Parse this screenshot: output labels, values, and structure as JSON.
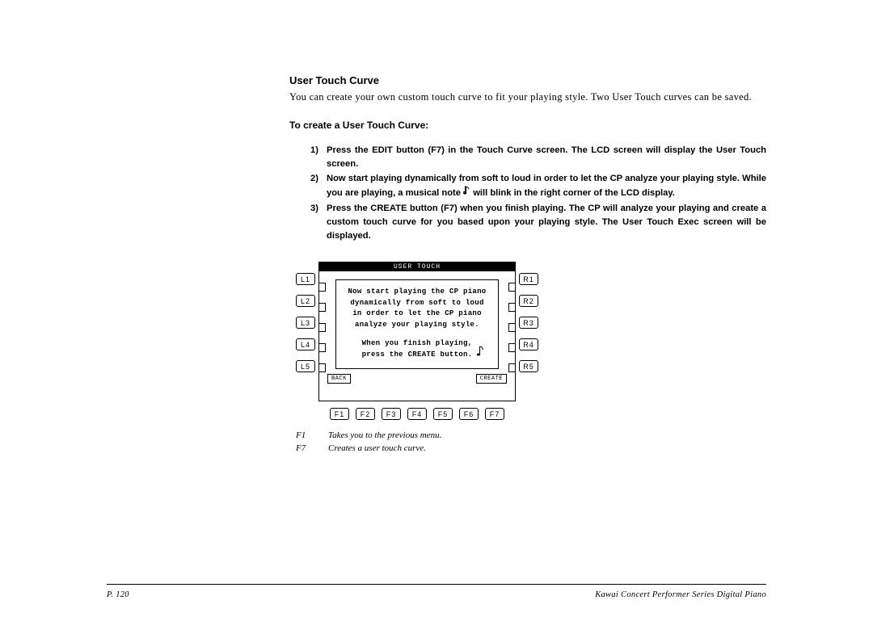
{
  "heading": "User Touch Curve",
  "intro": "You can create your own custom touch curve to fit your playing style.  Two User Touch curves can be saved.",
  "subheading": "To create a User Touch Curve:",
  "steps": [
    {
      "num": "1)",
      "text": "Press the EDIT button (F7) in the Touch Curve screen.  The LCD screen will display the User Touch screen."
    },
    {
      "num": "2)",
      "text_a": "Now start playing dynamically from soft to loud in order to let the CP analyze your playing style.  While you are playing, a musical note ",
      "text_b": " will blink in the right corner of the LCD display."
    },
    {
      "num": "3)",
      "text": "Press the CREATE button (F7) when you finish playing.  The CP will analyze your playing and create a custom touch curve for you based upon your playing style.  The User Touch Exec screen will be displayed."
    }
  ],
  "lcd": {
    "title": "USER TOUCH",
    "msg_line1": "Now start playing the CP piano",
    "msg_line2": "dynamically from soft to loud",
    "msg_line3": "in order to let the CP piano",
    "msg_line4": "analyze your playing style.",
    "msg_line5": "When you finish playing,",
    "msg_line6": "press the CREATE button.",
    "back": "BACK",
    "create": "CREATE"
  },
  "side_L": [
    "L1",
    "L2",
    "L3",
    "L4",
    "L5"
  ],
  "side_R": [
    "R1",
    "R2",
    "R3",
    "R4",
    "R5"
  ],
  "f_buttons": [
    "F1",
    "F2",
    "F3",
    "F4",
    "F5",
    "F6",
    "F7"
  ],
  "legend": [
    {
      "key": "F1",
      "desc": "Takes you to the previous menu."
    },
    {
      "key": "F7",
      "desc": "Creates a user touch curve."
    }
  ],
  "footer": {
    "page": "P. 120",
    "title": "Kawai Concert Performer Series Digital Piano"
  }
}
